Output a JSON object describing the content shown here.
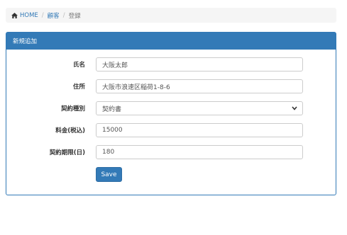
{
  "breadcrumb": {
    "home": "HOME",
    "customers": "顧客",
    "current": "登録"
  },
  "panel": {
    "title": "新規追加"
  },
  "form": {
    "name_label": "氏名",
    "name_value": "大阪太郎",
    "address_label": "住所",
    "address_value": "大阪市浪速区稲荷1-8-6",
    "contract_type_label": "契約種別",
    "contract_type_value": "契約書",
    "fee_label": "料金(税込)",
    "fee_value": "15000",
    "period_label": "契約期限(日)",
    "period_value": "180",
    "save_label": "Save"
  },
  "colors": {
    "primary": "#337ab7",
    "breadcrumb_bg": "#f5f5f5"
  }
}
